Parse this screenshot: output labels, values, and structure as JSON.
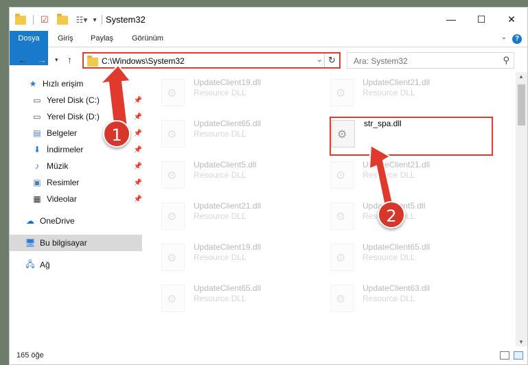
{
  "window": {
    "title": "System32",
    "controls": {
      "minimize": "—",
      "maximize": "☐",
      "close": "✕"
    }
  },
  "ribbon": {
    "tabs": [
      {
        "label": "Dosya"
      },
      {
        "label": "Giriş"
      },
      {
        "label": "Paylaş"
      },
      {
        "label": "Görünüm"
      }
    ],
    "help": "?"
  },
  "address": {
    "path": "C:\\Windows\\System32",
    "search_placeholder": "Ara: System32"
  },
  "sidebar": {
    "items": [
      {
        "label": "Hızlı erişim",
        "icon": "star-icon"
      },
      {
        "label": "Yerel Disk (C:)",
        "icon": "drive-icon"
      },
      {
        "label": "Yerel Disk (D:)",
        "icon": "drive-icon"
      },
      {
        "label": "Belgeler",
        "icon": "documents-icon"
      },
      {
        "label": "İndirmeler",
        "icon": "download-icon"
      },
      {
        "label": "Müzik",
        "icon": "music-icon"
      },
      {
        "label": "Resimler",
        "icon": "pictures-icon"
      },
      {
        "label": "Videolar",
        "icon": "video-icon"
      },
      {
        "label": "OneDrive",
        "icon": "cloud-icon"
      },
      {
        "label": "Bu bilgisayar",
        "icon": "computer-icon"
      },
      {
        "label": "Ağ",
        "icon": "network-icon"
      }
    ]
  },
  "files": [
    {
      "name": "UpdateClient19.dll",
      "type": "Resource DLL"
    },
    {
      "name": "UpdateClient21.dll",
      "type": "Resource DLL"
    },
    {
      "name": "UpdateClient65.dll",
      "type": "Resource DLL"
    },
    {
      "name": "str_spa.dll",
      "type": ""
    },
    {
      "name": "UpdateClient5.dll",
      "type": "Resource DLL"
    },
    {
      "name": "UpdateClient21.dll",
      "type": "Resource DLL"
    },
    {
      "name": "UpdateClient21.dll",
      "type": "Resource DLL"
    },
    {
      "name": "UpdateClient5.dll",
      "type": "Resource DLL"
    },
    {
      "name": "UpdateClient19.dll",
      "type": "Resource DLL"
    },
    {
      "name": "UpdateClient65.dll",
      "type": "Resource DLL"
    },
    {
      "name": "UpdateClient65.dll",
      "type": "Resource DLL"
    },
    {
      "name": "UpdateClient63.dll",
      "type": "Resource DLL"
    }
  ],
  "status": {
    "count": "165 öğe"
  },
  "annotations": {
    "step1": "1",
    "step2": "2",
    "accent": "#d6372b"
  }
}
